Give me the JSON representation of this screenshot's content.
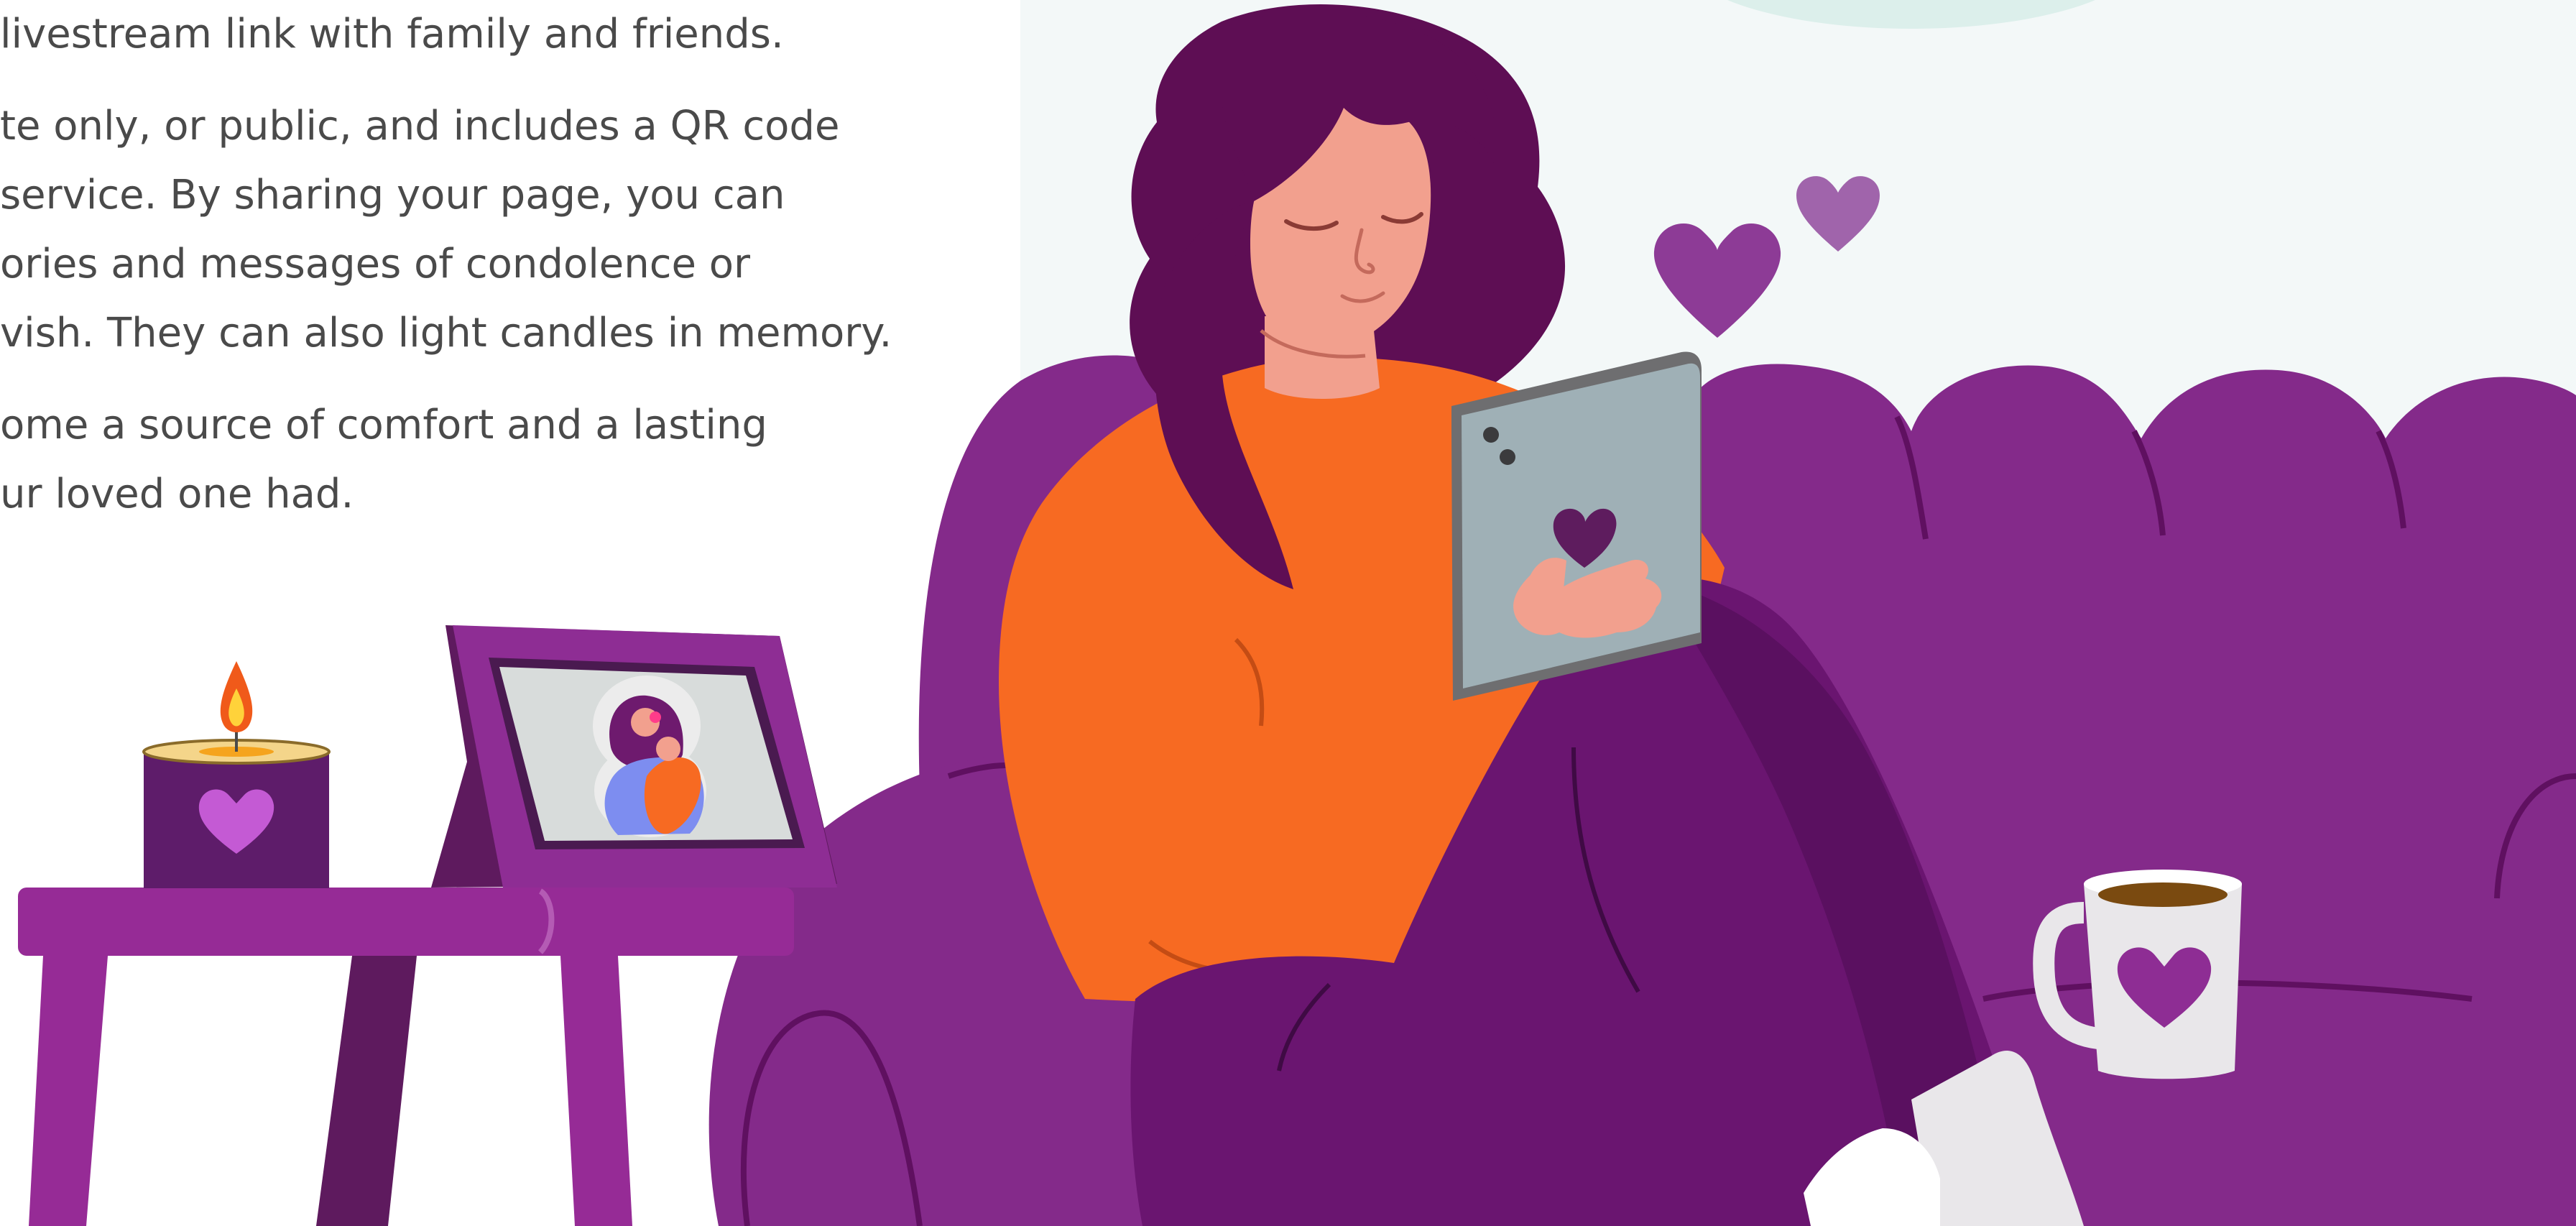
{
  "text": {
    "line1": "livestream link with family and friends.",
    "line2": "te only, or public, and includes a QR code",
    "line3": "service. By sharing your page, you can",
    "line4": "ories and messages of condolence or",
    "line5": "vish. They can also light candles in memory.",
    "line6": "ome a source of comfort and a lasting",
    "line7": "ur loved one had."
  },
  "colors": {
    "sofa": "#842a8a",
    "sofa_dark": "#5f1060",
    "hair": "#5e0e54",
    "skin": "#f2a08e",
    "sweater": "#f76a22",
    "pants": "#6a1570",
    "tablet": "#9fb0b6",
    "table": "#962b96",
    "candle": "#5e1c6a",
    "frame": "#8e2d94",
    "mug": "#e9e7ea",
    "heart_light": "#a064ab",
    "heart": "#8d3b96",
    "bg_tint": "#f3f8f8"
  },
  "icons": [
    "heart-icon",
    "candle-flame-icon",
    "photo-frame-icon",
    "tablet-heart-icon",
    "mug-heart-icon"
  ]
}
